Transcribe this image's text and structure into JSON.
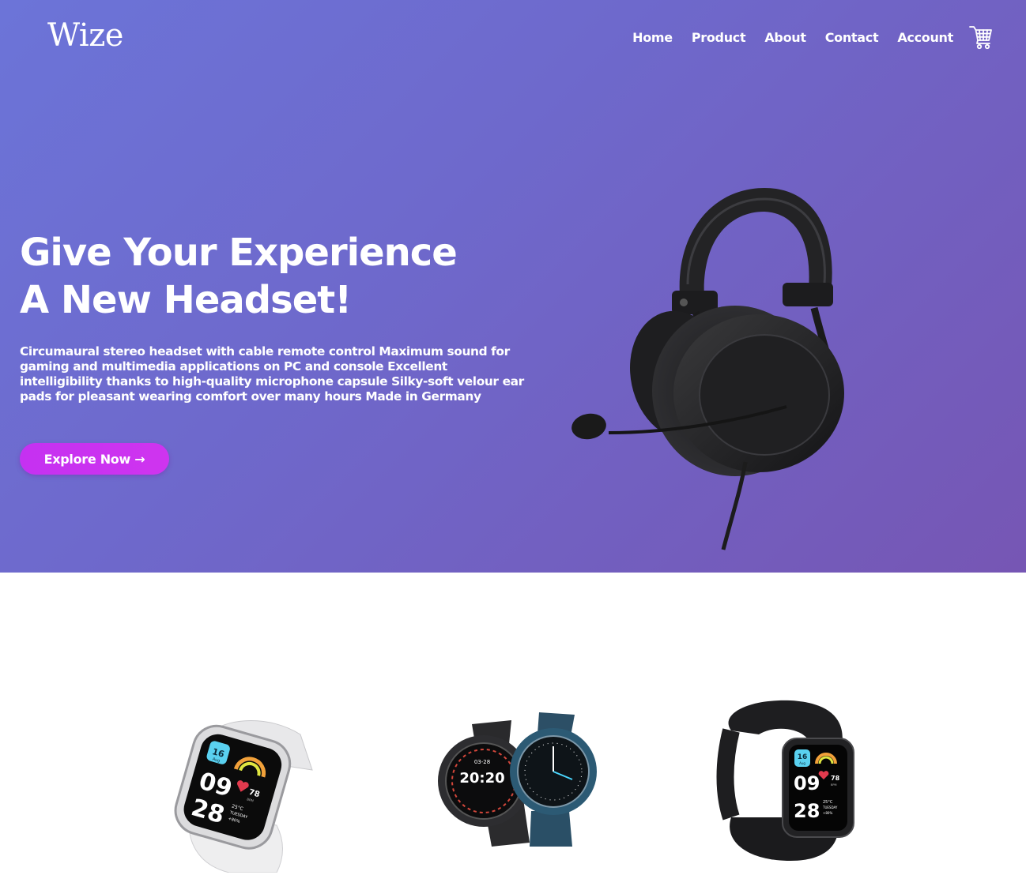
{
  "brand": {
    "logo": "Wize"
  },
  "nav": {
    "items": [
      {
        "label": "Home"
      },
      {
        "label": "Product"
      },
      {
        "label": "About"
      },
      {
        "label": "Contact"
      },
      {
        "label": "Account"
      }
    ],
    "cart_icon": "shopping-cart-icon"
  },
  "hero": {
    "title_line1": "Give Your Experience",
    "title_line2": "A New Headset!",
    "description": "Circumaural stereo headset with cable remote control Maximum sound for gaming and multimedia applications on PC and console Excellent intelligibility thanks to high-quality microphone capsule Silky-soft velour ear pads for pleasant wearing comfort over many hours Made in Germany",
    "cta_label": "Explore Now →",
    "colors": {
      "gradient_start": "#6c74d8",
      "gradient_end": "#7656b4",
      "cta": "#c531f1"
    }
  },
  "products": {
    "items": [
      {
        "image": "white-smartwatch",
        "face": {
          "date_day": "16",
          "date_month": "Aug",
          "hour": "09",
          "minute": "28",
          "bpm": "78",
          "bpm_unit": "BPM",
          "temp": "25°C",
          "weekday": "TUESDAY",
          "battery": "+80%"
        }
      },
      {
        "image": "smartwatch-pair",
        "face": {
          "date": "03-28",
          "time": "20:20"
        }
      },
      {
        "image": "black-smartwatch",
        "face": {
          "date_day": "16",
          "date_month": "Aug",
          "hour": "09",
          "minute": "28",
          "bpm": "78",
          "bpm_unit": "BPM",
          "temp": "25°C",
          "weekday": "TUESDAY",
          "battery": "+80%"
        }
      }
    ]
  }
}
